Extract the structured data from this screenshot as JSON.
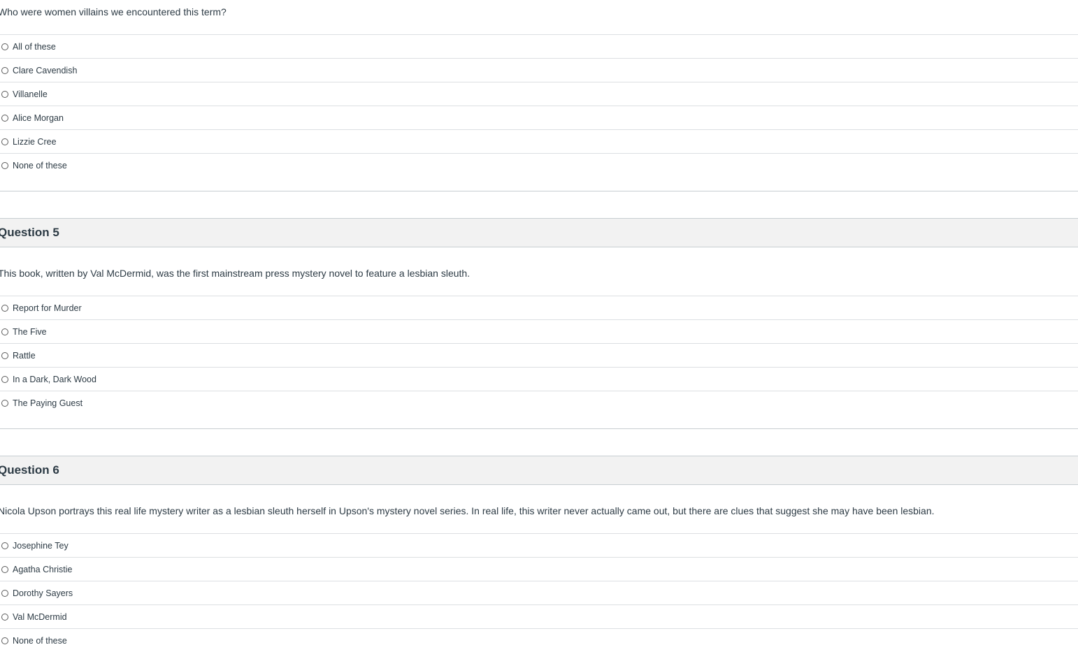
{
  "q4": {
    "text": "Who were women villains we encountered this term?",
    "answers": [
      "All of these",
      "Clare Cavendish",
      "Villanelle",
      "Alice Morgan",
      "Lizzie Cree",
      "None of these"
    ]
  },
  "q5": {
    "title": "Question 5",
    "text": "This book, written by Val McDermid, was the first mainstream press mystery novel to feature a lesbian sleuth.",
    "answers": [
      "Report for Murder",
      "The Five",
      "Rattle",
      "In a Dark, Dark Wood",
      "The Paying Guest"
    ]
  },
  "q6": {
    "title": "Question 6",
    "text": "Nicola Upson portrays this real life mystery writer as a lesbian sleuth herself in Upson's mystery novel series. In real life, this writer never actually came out, but there are clues that suggest she may have been lesbian.",
    "answers": [
      "Josephine Tey",
      "Agatha Christie",
      "Dorothy Sayers",
      "Val McDermid",
      "None of these"
    ]
  }
}
